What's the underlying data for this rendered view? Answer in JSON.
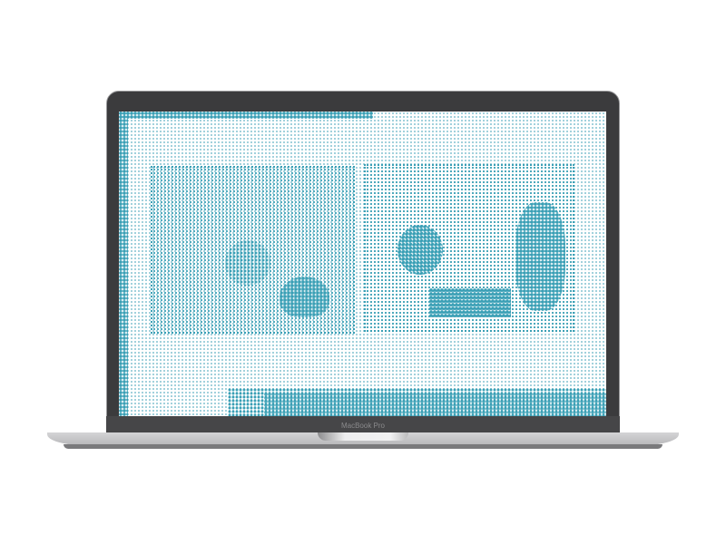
{
  "device": {
    "brand_label": "MacBook Pro"
  },
  "screen": {
    "content": "halftone-dot-image",
    "accent_color": "#3a9fb5"
  }
}
